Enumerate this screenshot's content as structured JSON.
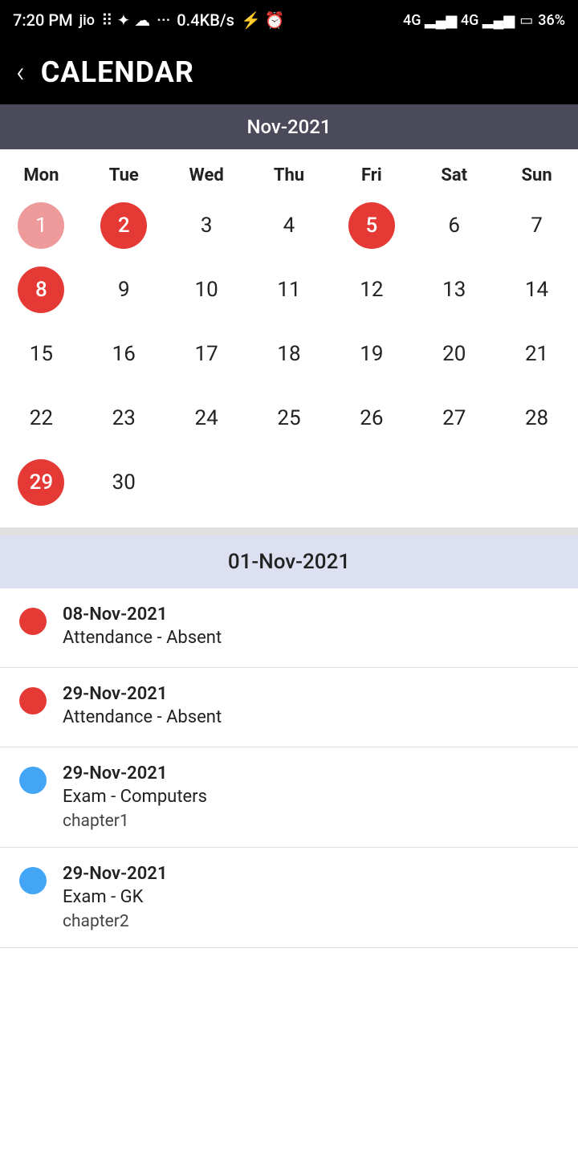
{
  "statusBar": {
    "time": "7:20 PM",
    "network": "0.4KB/s",
    "battery": "36%"
  },
  "header": {
    "backLabel": "‹",
    "title": "CALENDAR"
  },
  "calendar": {
    "monthLabel": "Nov-2021",
    "dayHeaders": [
      "Mon",
      "Tue",
      "Wed",
      "Thu",
      "Fri",
      "Sat",
      "Sun"
    ],
    "weeks": [
      [
        {
          "num": "1",
          "style": "red-light"
        },
        {
          "num": "2",
          "style": "red-circle"
        },
        {
          "num": "3",
          "style": ""
        },
        {
          "num": "4",
          "style": ""
        },
        {
          "num": "5",
          "style": "red-circle"
        },
        {
          "num": "6",
          "style": ""
        },
        {
          "num": "7",
          "style": ""
        }
      ],
      [
        {
          "num": "8",
          "style": "red-circle"
        },
        {
          "num": "9",
          "style": ""
        },
        {
          "num": "10",
          "style": ""
        },
        {
          "num": "11",
          "style": ""
        },
        {
          "num": "12",
          "style": ""
        },
        {
          "num": "13",
          "style": ""
        },
        {
          "num": "14",
          "style": ""
        }
      ],
      [
        {
          "num": "15",
          "style": ""
        },
        {
          "num": "16",
          "style": ""
        },
        {
          "num": "17",
          "style": ""
        },
        {
          "num": "18",
          "style": ""
        },
        {
          "num": "19",
          "style": ""
        },
        {
          "num": "20",
          "style": ""
        },
        {
          "num": "21",
          "style": ""
        }
      ],
      [
        {
          "num": "22",
          "style": ""
        },
        {
          "num": "23",
          "style": ""
        },
        {
          "num": "24",
          "style": ""
        },
        {
          "num": "25",
          "style": ""
        },
        {
          "num": "26",
          "style": ""
        },
        {
          "num": "27",
          "style": ""
        },
        {
          "num": "28",
          "style": ""
        }
      ],
      [
        {
          "num": "29",
          "style": "red-circle"
        },
        {
          "num": "30",
          "style": ""
        },
        {
          "num": "",
          "style": "empty"
        },
        {
          "num": "",
          "style": "empty"
        },
        {
          "num": "",
          "style": "empty"
        },
        {
          "num": "",
          "style": "empty"
        },
        {
          "num": "",
          "style": "empty"
        }
      ]
    ]
  },
  "eventSection": {
    "dateHeader": "01-Nov-2021",
    "events": [
      {
        "dotColor": "dot-red",
        "date": "08-Nov-2021",
        "description": "Attendance - Absent",
        "sub": ""
      },
      {
        "dotColor": "dot-red",
        "date": "29-Nov-2021",
        "description": "Attendance - Absent",
        "sub": ""
      },
      {
        "dotColor": "dot-blue",
        "date": "29-Nov-2021",
        "description": "Exam - Computers",
        "sub": "chapter1"
      },
      {
        "dotColor": "dot-blue",
        "date": "29-Nov-2021",
        "description": "Exam - GK",
        "sub": "chapter2"
      }
    ]
  }
}
